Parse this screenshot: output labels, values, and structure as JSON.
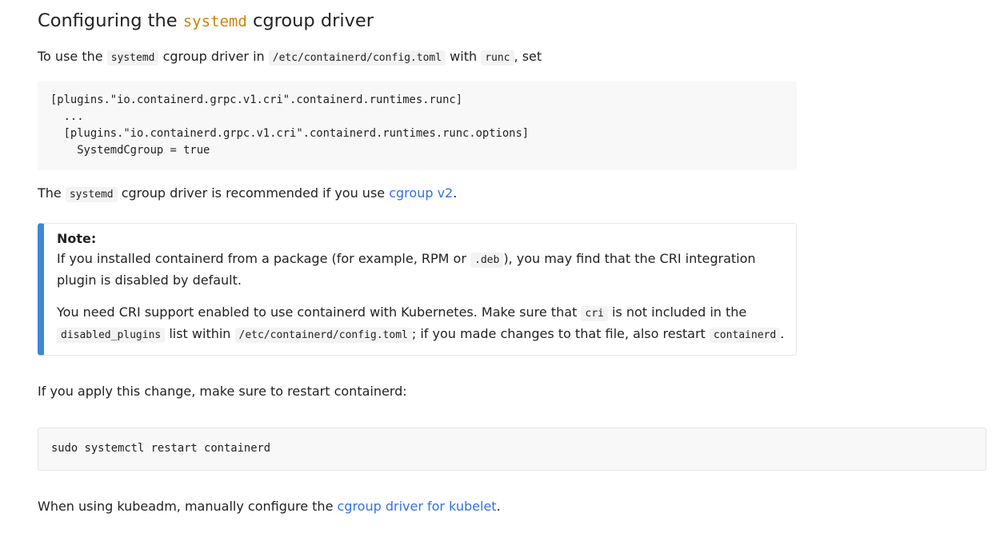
{
  "heading": {
    "prefix": "Configuring the ",
    "code": "systemd",
    "suffix": " cgroup driver"
  },
  "para1": {
    "t1": "To use the ",
    "c1": "systemd",
    "t2": " cgroup driver in ",
    "c2": "/etc/containerd/config.toml",
    "t3": " with ",
    "c3": "runc",
    "t4": ", set"
  },
  "code1": {
    "lines": [
      "[plugins.\"io.containerd.grpc.v1.cri\".containerd.runtimes.runc]",
      "  ...",
      "  [plugins.\"io.containerd.grpc.v1.cri\".containerd.runtimes.runc.options]",
      "    SystemdCgroup = true"
    ]
  },
  "para2": {
    "t1": "The ",
    "c1": "systemd",
    "t2": " cgroup driver is recommended if you use ",
    "link": "cgroup v2",
    "t3": "."
  },
  "note": {
    "title": "Note:",
    "p1": {
      "t1": "If you installed containerd from a package (for example, RPM or ",
      "c1": ".deb",
      "t2": "), you may find that the CRI integration plugin is disabled by default."
    },
    "p2": {
      "t1": "You need CRI support enabled to use containerd with Kubernetes. Make sure that ",
      "c1": "cri",
      "t2": " is not included in the ",
      "c2": "disabled_plugins",
      "t3": " list within ",
      "c3": "/etc/containerd/config.toml",
      "t4": "; if you made changes to that file, also restart ",
      "c4": "containerd",
      "t5": "."
    }
  },
  "para3": "If you apply this change, make sure to restart containerd:",
  "code2": "sudo systemctl restart containerd",
  "para4": {
    "t1": "When using kubeadm, manually configure the ",
    "link": "cgroup driver for kubelet",
    "t2": "."
  }
}
